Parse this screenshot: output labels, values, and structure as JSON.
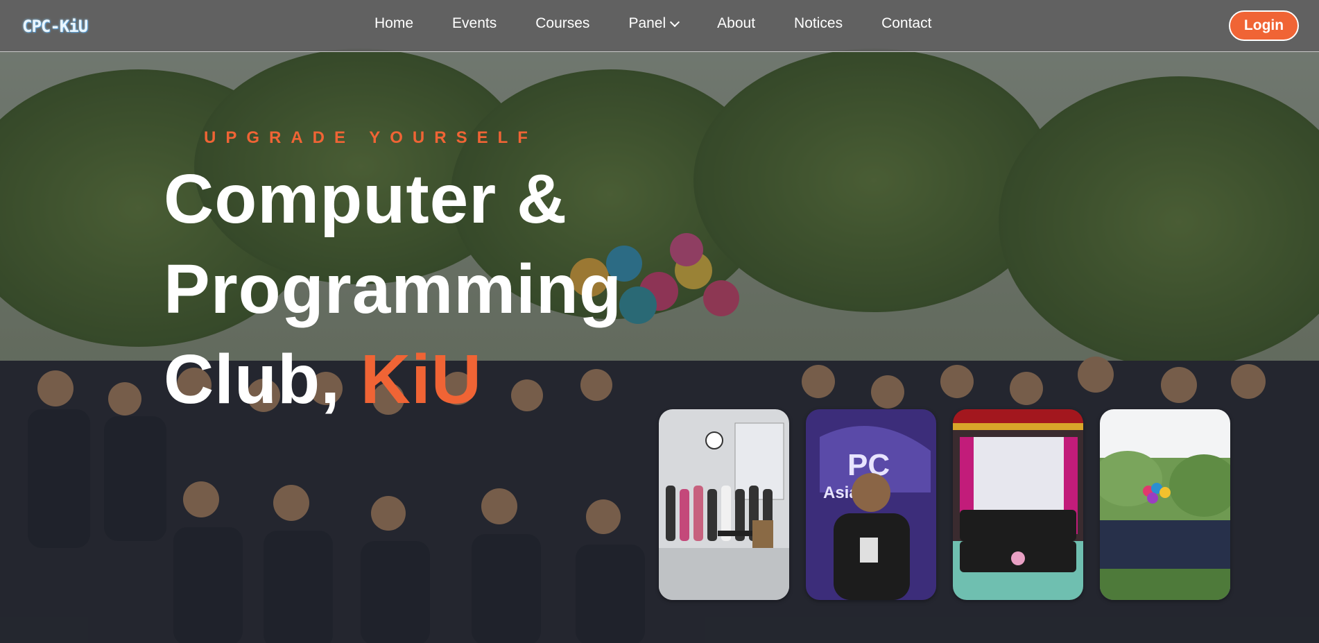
{
  "nav": {
    "logo": "CPC-KiU",
    "links": [
      "Home",
      "Events",
      "Courses",
      "Panel",
      "About",
      "Notices",
      "Contact"
    ],
    "login": "Login"
  },
  "hero": {
    "eyebrow": "UPGRADE YOURSELF",
    "title_line1": "Computer &",
    "title_line2": "Programming",
    "title_line3_prefix": "Club, ",
    "title_line3_accent": "KiU"
  },
  "colors": {
    "accent": "#f06435",
    "nav_bg": "#5f5f5f"
  }
}
